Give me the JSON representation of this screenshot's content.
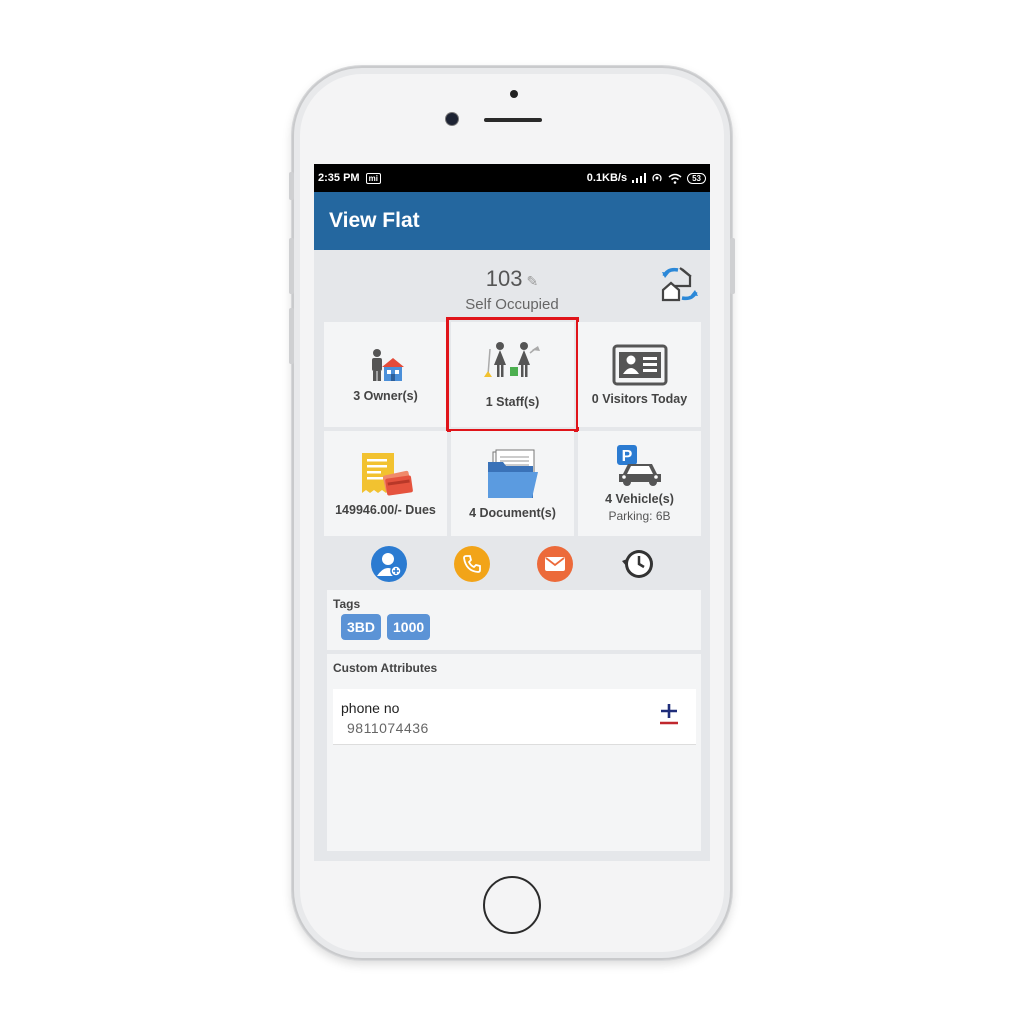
{
  "status_bar": {
    "time": "2:35 PM",
    "carrier_badge": "mi",
    "network_speed": "0.1KB/s",
    "battery": "53"
  },
  "app_bar": {
    "title": "View Flat"
  },
  "flat": {
    "number": "103",
    "status": "Self Occupied"
  },
  "tiles": {
    "owners": {
      "label": "3 Owner(s)",
      "icon": "owner-house-icon"
    },
    "staff": {
      "label": "1 Staff(s)",
      "icon": "staff-icon"
    },
    "visitors": {
      "label": "0 Visitors Today",
      "icon": "id-card-icon"
    },
    "dues": {
      "label": "149946.00/- Dues",
      "icon": "bill-cards-icon"
    },
    "documents": {
      "label": "4 Document(s)",
      "icon": "folder-documents-icon"
    },
    "vehicles": {
      "label": "4 Vehicle(s)",
      "sub": "Parking: 6B",
      "icon": "parking-car-icon"
    }
  },
  "actions": [
    {
      "icon": "add-user-icon",
      "color": "#2b7bd1"
    },
    {
      "icon": "phone-icon",
      "color": "#f2a418"
    },
    {
      "icon": "email-icon",
      "color": "#ec6a3a"
    },
    {
      "icon": "history-icon",
      "color": "#333333"
    }
  ],
  "tags": {
    "title": "Tags",
    "items": [
      "3BD",
      "1000"
    ]
  },
  "custom_attributes": {
    "title": "Custom Attributes",
    "items": [
      {
        "name": "phone no",
        "value": "9811074436"
      }
    ]
  },
  "colors": {
    "app_bar": "#24679f",
    "highlight": "#e0141a",
    "tag": "#5b93d6"
  }
}
